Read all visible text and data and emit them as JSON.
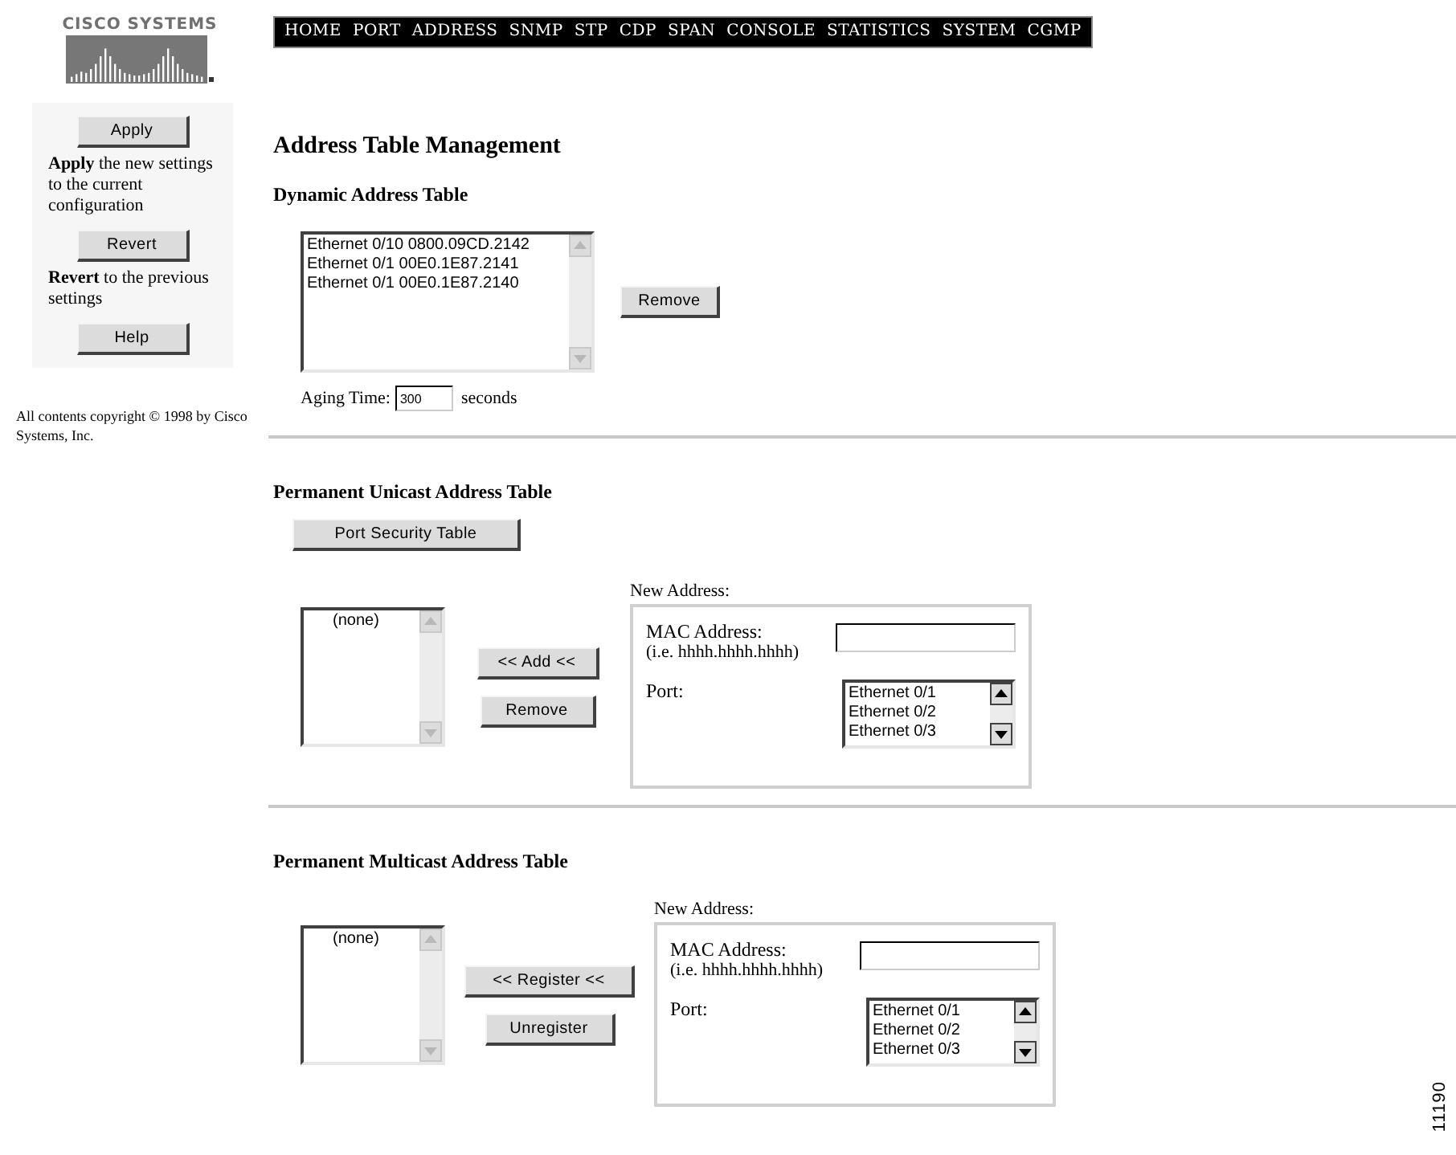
{
  "logo": {
    "text": "CISCO SYSTEMS"
  },
  "sidebar": {
    "buttons": [
      {
        "label": "Apply",
        "description": "**Apply** the new settings to the current configuration"
      },
      {
        "label": "Revert",
        "description": "**Revert** to the previous settings"
      },
      {
        "label": "Help"
      }
    ],
    "copyright": "All contents copyright © 1998 by Cisco Systems, Inc."
  },
  "nav": {
    "items": [
      "HOME",
      "PORT",
      "ADDRESS",
      "SNMP",
      "STP",
      "CDP",
      "SPAN",
      "CONSOLE",
      "STATISTICS",
      "SYSTEM",
      "CGMP"
    ]
  },
  "title": "Address Table Management",
  "dynamic": {
    "heading": "Dynamic Address Table",
    "entries": [
      "Ethernet 0/10 0800.09CD.2142",
      "Ethernet 0/1 00E0.1E87.2141",
      "Ethernet 0/1 00E0.1E87.2140"
    ],
    "remove_button": "Remove",
    "aging_label": "Aging Time:",
    "aging_value": "300",
    "aging_unit": "seconds"
  },
  "sections": [
    {
      "heading": "Permanent Unicast Address Table",
      "extra_button": "Port Security Table",
      "entries": [
        "(none)"
      ],
      "add_button": "<< Add <<",
      "remove_button": "Remove",
      "new_address": {
        "label": "New Address:",
        "mac_label": "MAC Address:",
        "mac_hint": "(i.e. hhhh.hhhh.hhhh)",
        "port_label": "Port:",
        "ports": [
          "Ethernet 0/1",
          "Ethernet 0/2",
          "Ethernet 0/3"
        ]
      }
    },
    {
      "heading": "Permanent Multicast Address Table",
      "entries": [
        "(none)"
      ],
      "add_button": "<< Register <<",
      "remove_button": "Unregister",
      "new_address": {
        "label": "New Address:",
        "mac_label": "MAC Address:",
        "mac_hint": "(i.e. hhhh.hhhh.hhhh)",
        "port_label": "Port:",
        "ports": [
          "Ethernet 0/1",
          "Ethernet 0/2",
          "Ethernet 0/3"
        ]
      }
    }
  ],
  "figure_number": "11190"
}
